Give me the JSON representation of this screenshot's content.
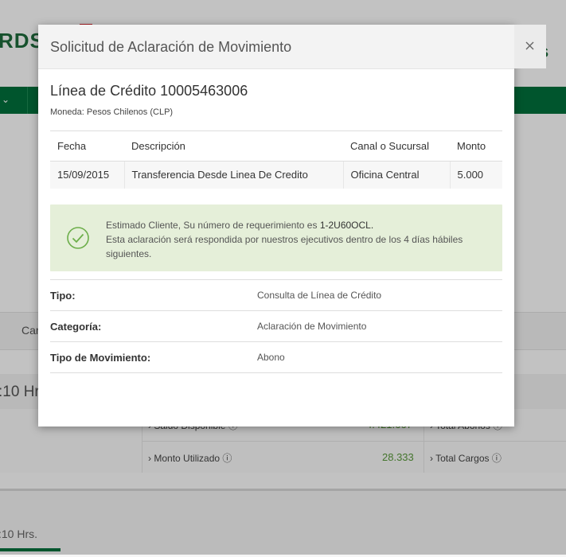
{
  "background": {
    "logo_text": "RDS",
    "right_logo_fragment": "s",
    "tab_fragment": "Car",
    "hours_label_1": ":10 Hr",
    "hours_label_2": ":10 Hrs.",
    "saldo_label": "Saldo Disponible",
    "saldo_value": "4.421.667",
    "total_abonos_label": "Total Abonos",
    "monto_utilizado_label": "Monto Utilizado",
    "monto_utilizado_value": "28.333",
    "total_cargos_label": "Total Cargos",
    "colors": {
      "brand_green": "#00703c"
    }
  },
  "modal": {
    "title": "Solicitud de Aclaración de Movimiento",
    "close_icon": "close-icon",
    "credit_line_title": "Línea de Crédito 10005463006",
    "currency": "Moneda: Pesos Chilenos (CLP)",
    "table": {
      "headers": [
        "Fecha",
        "Descripción",
        "Canal o Sucursal",
        "Monto"
      ],
      "rows": [
        [
          "15/09/2015",
          "Transferencia Desde Linea De Credito",
          "Oficina Central",
          "5.000"
        ]
      ]
    },
    "alert": {
      "icon": "check-circle-icon",
      "line1_prefix": "Estimado Cliente, Su número de requerimiento es ",
      "request_number": "1-2U60OCL.",
      "line2": "Esta aclaración será respondida por nuestros ejecutivos dentro de los 4 días hábiles siguientes.",
      "color": "#e5efd9",
      "icon_color": "#6cae4a"
    },
    "details": [
      {
        "label": "Tipo:",
        "value": "Consulta de Línea de Crédito"
      },
      {
        "label": "Categoría:",
        "value": "Aclaración de Movimiento"
      },
      {
        "label": "Tipo de Movimiento:",
        "value": "Abono"
      }
    ]
  }
}
